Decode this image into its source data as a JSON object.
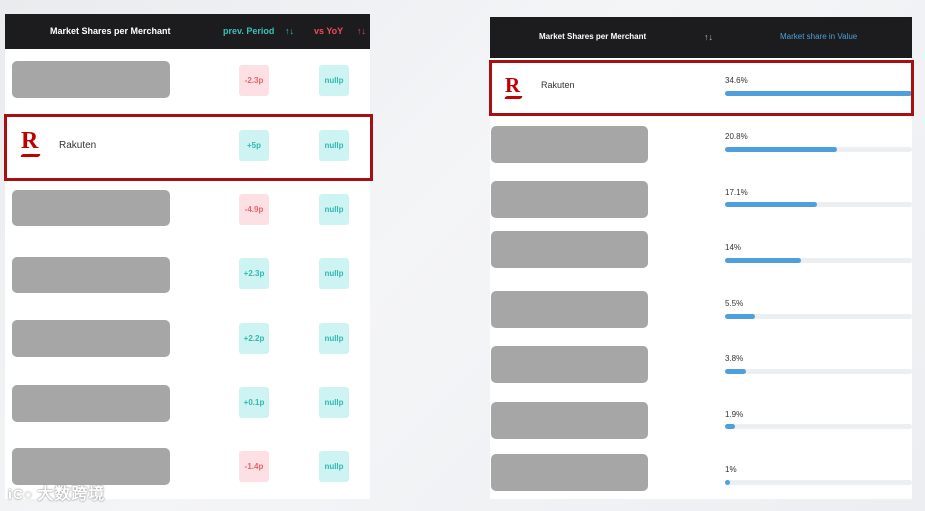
{
  "left_table": {
    "header": {
      "merchant_col": "Market Shares per Merchant",
      "prev_col": "prev. Period",
      "yoy_col": "vs YoY",
      "sort_icon": "↑↓",
      "prev_color": "#34c3b7",
      "yoy_color": "#ef4b5a"
    },
    "rows": [
      {
        "merchant": "",
        "prev": "-2.3p",
        "prev_sign": "neg",
        "yoy": "nullp"
      },
      {
        "merchant": "Rakuten",
        "prev": "+5p",
        "prev_sign": "pos",
        "yoy": "nullp"
      },
      {
        "merchant": "",
        "prev": "-4.9p",
        "prev_sign": "neg",
        "yoy": "nullp"
      },
      {
        "merchant": "",
        "prev": "+2.3p",
        "prev_sign": "pos",
        "yoy": "nullp"
      },
      {
        "merchant": "",
        "prev": "+2.2p",
        "prev_sign": "pos",
        "yoy": "nullp"
      },
      {
        "merchant": "",
        "prev": "+0.1p",
        "prev_sign": "pos",
        "yoy": "nullp"
      },
      {
        "merchant": "",
        "prev": "-1.4p",
        "prev_sign": "neg",
        "yoy": "nullp"
      }
    ]
  },
  "right_table": {
    "header": {
      "merchant_col": "Market Shares per Merchant",
      "sort_icon": "↑↓",
      "value_col": "Market share in Value",
      "value_color": "#4e9fdc"
    },
    "rows": [
      {
        "merchant": "Rakuten",
        "share_label": "34.6%",
        "share": 34.6
      },
      {
        "merchant": "",
        "share_label": "20.8%",
        "share": 20.8
      },
      {
        "merchant": "",
        "share_label": "17.1%",
        "share": 17.1
      },
      {
        "merchant": "",
        "share_label": "14%",
        "share": 14
      },
      {
        "merchant": "",
        "share_label": "5.5%",
        "share": 5.5
      },
      {
        "merchant": "",
        "share_label": "3.8%",
        "share": 3.8
      },
      {
        "merchant": "",
        "share_label": "1.9%",
        "share": 1.9
      },
      {
        "merchant": "",
        "share_label": "1%",
        "share": 1
      }
    ]
  },
  "brand": {
    "logo_letter": "R",
    "logo_color": "#bf0000",
    "highlight_color": "#a80f12"
  },
  "watermark": {
    "text": "大数跨境"
  }
}
